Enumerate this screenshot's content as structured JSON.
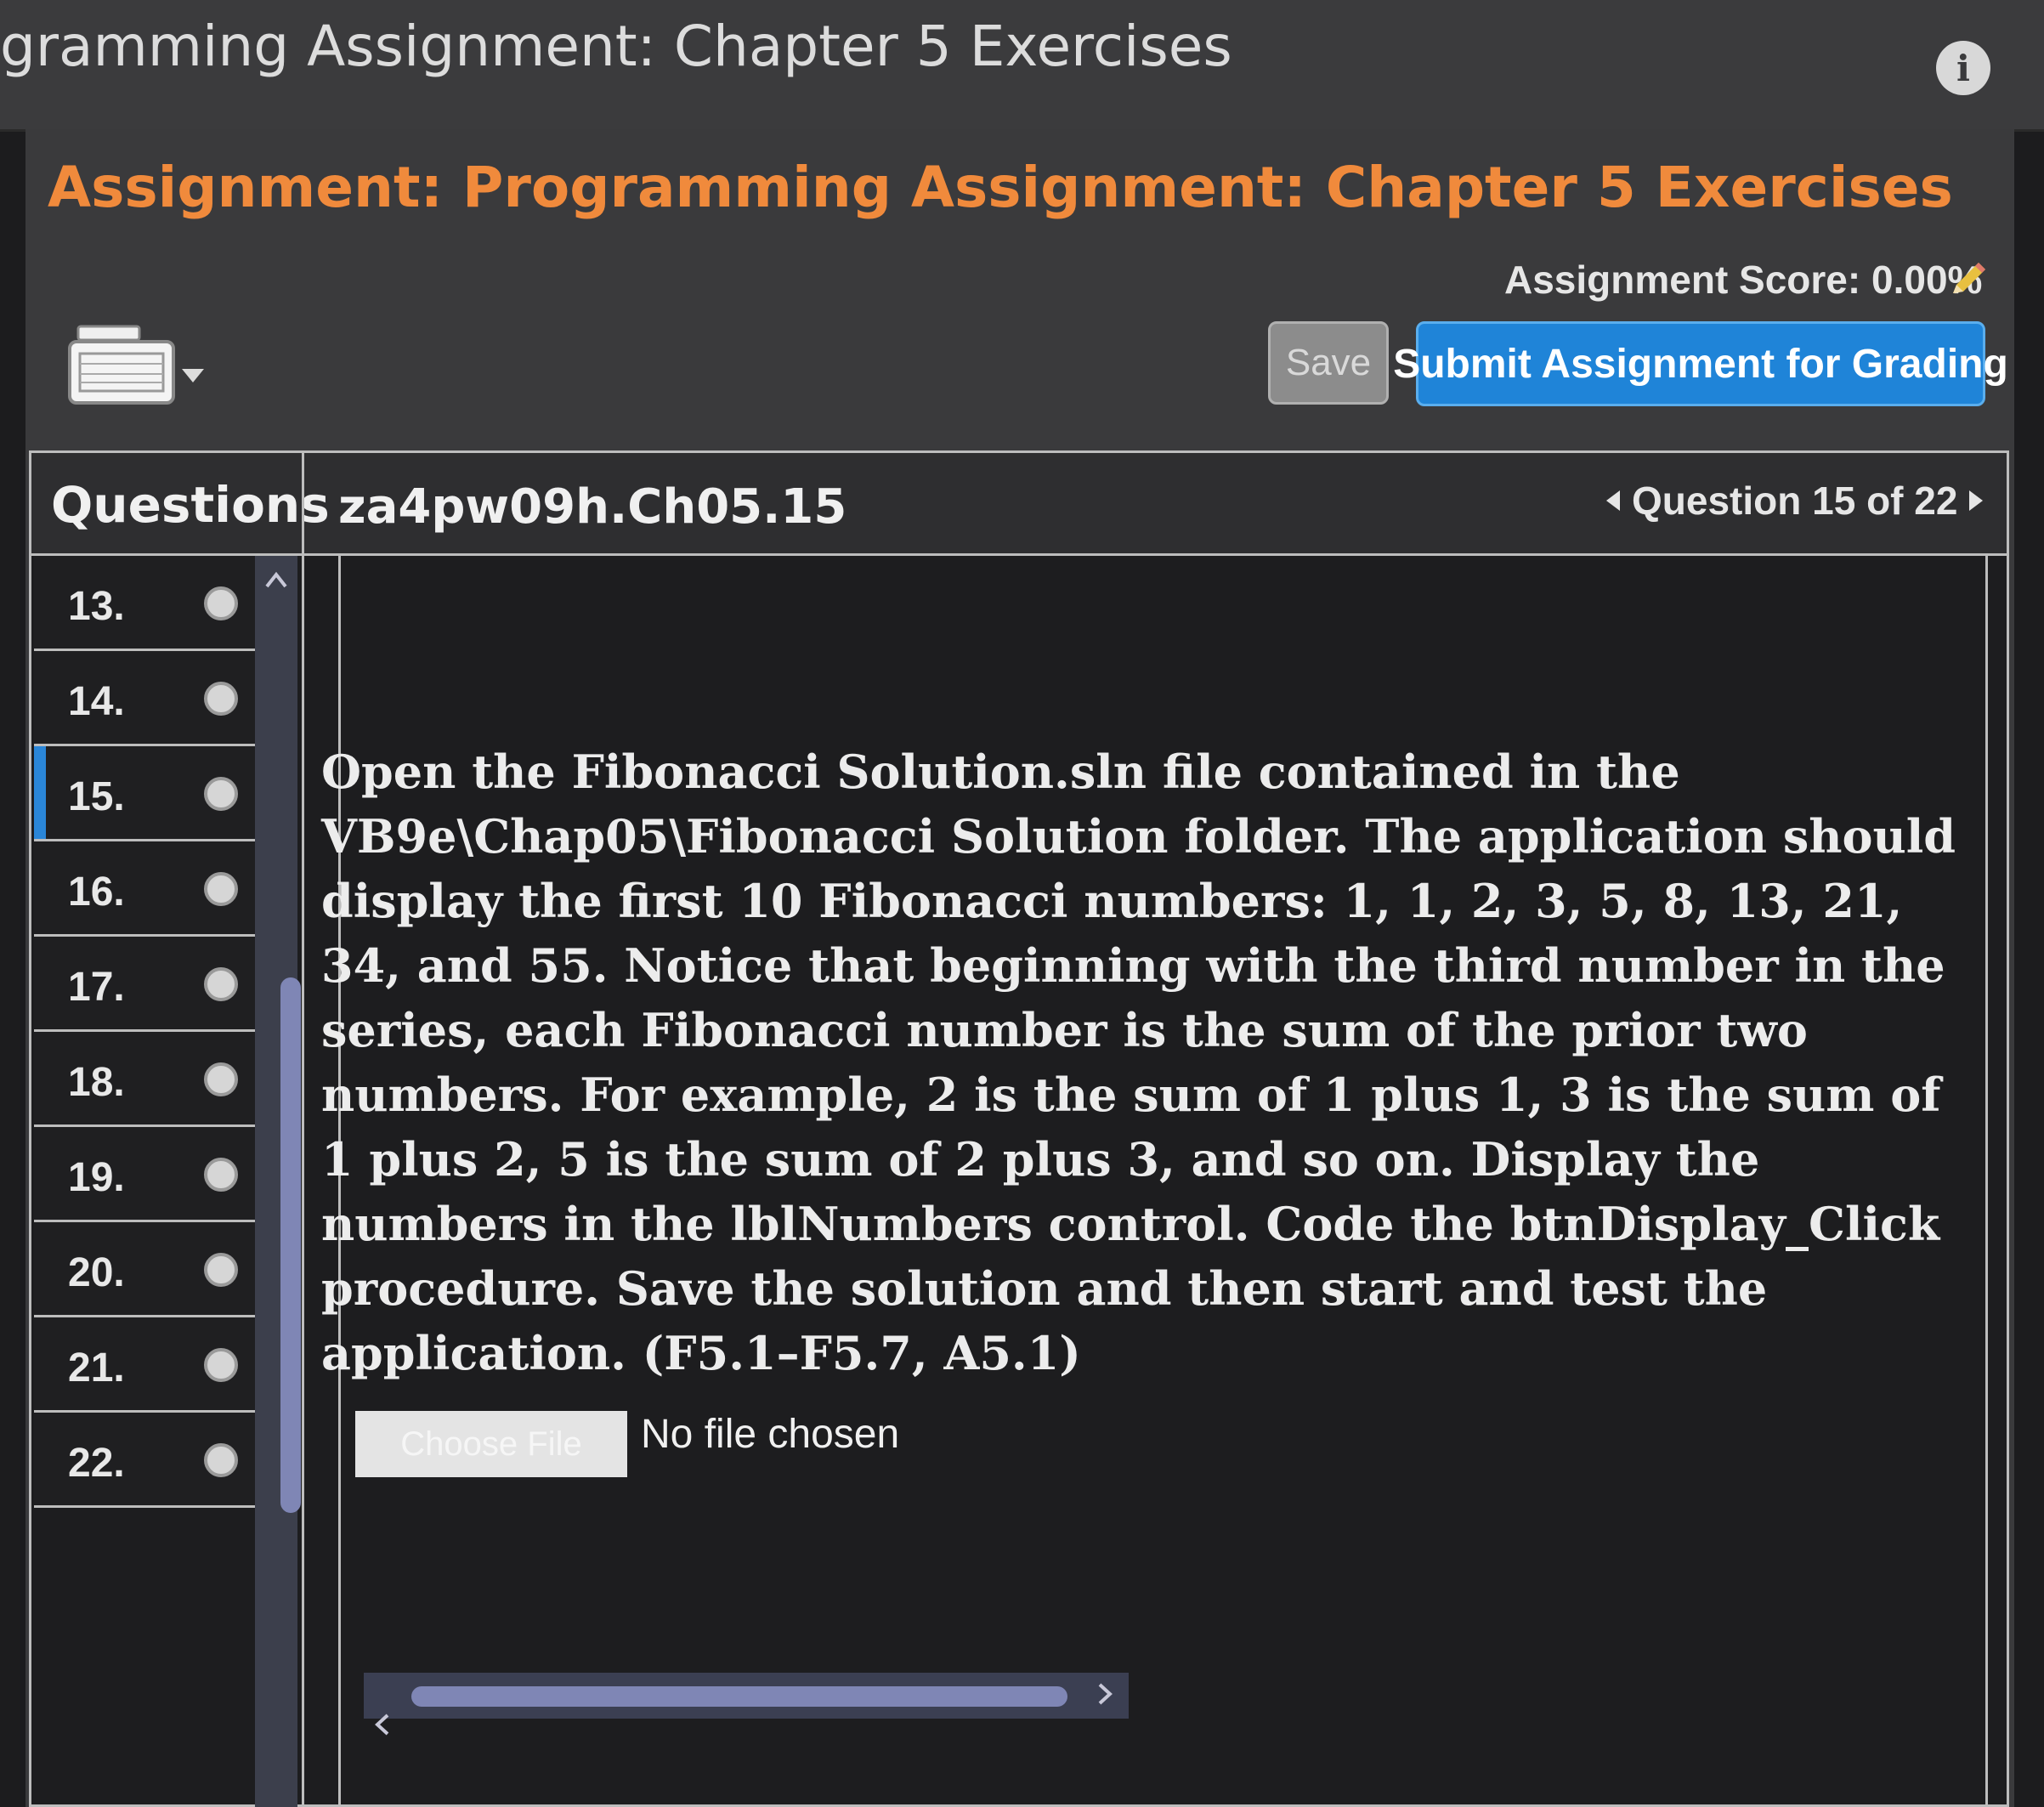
{
  "window": {
    "title": "gramming Assignment: Chapter 5 Exercises"
  },
  "assignment": {
    "title": "Assignment: Programming Assignment: Chapter 5 Exercises",
    "score_text": "Assignment Score: 0.00%",
    "save_label": "Save",
    "submit_label": "Submit Assignment for Grading"
  },
  "questions_panel": {
    "heading": "Questions",
    "items": [
      {
        "label": "13."
      },
      {
        "label": "14."
      },
      {
        "label": "15."
      },
      {
        "label": "16."
      },
      {
        "label": "17."
      },
      {
        "label": "18."
      },
      {
        "label": "19."
      },
      {
        "label": "20."
      },
      {
        "label": "21."
      },
      {
        "label": "22."
      }
    ],
    "active_label": "15."
  },
  "question": {
    "id": "za4pw09h.Ch05.15",
    "nav_text": "Question 15 of 22",
    "prompt": "Open the Fibonacci Solution.sln file contained in the VB9e\\Chap05\\Fibonacci Solution folder. The application should display the first 10 Fibonacci numbers: 1, 1, 2, 3, 5, 8, 13, 21, 34, and 55. Notice that beginning with the third number in the series, each Fibonacci number is the sum of the prior two numbers. For example, 2 is the sum of 1 plus 1, 3 is the sum of 1 plus 2, 5 is the sum of 2 plus 3, and so on. Display the numbers in the lblNumbers control. Code the btnDisplay_Click procedure. Save the solution and then start and test the application. (F5.1–F5.7, A5.1)"
  },
  "file_upload": {
    "button_label": "Choose File",
    "status": "No file chosen"
  },
  "colors": {
    "title_orange": "#f08a3c",
    "submit_blue": "#1f84d8",
    "active_marker": "#2a86d8"
  },
  "icons": [
    "info-icon",
    "pencil-icon",
    "keyboard-icon",
    "caret-down-icon",
    "chevron-left-icon",
    "chevron-right-icon",
    "chevron-up-icon"
  ]
}
